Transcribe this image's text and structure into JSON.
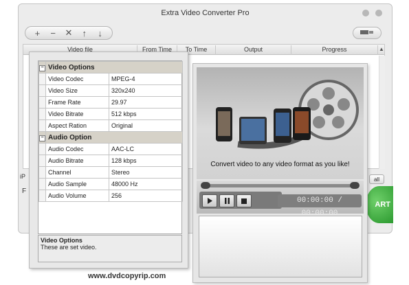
{
  "window": {
    "title": "Extra Video Converter Pro",
    "columns": [
      "Video file",
      "From Time",
      "To Time",
      "Output",
      "Progress"
    ]
  },
  "toolbar": {
    "add": "+",
    "remove": "−",
    "clear": "✕",
    "up": "↑",
    "down": "↓"
  },
  "bottom": {
    "partial_label_left": "iP",
    "partial_label_f": "F",
    "all_label": "all",
    "start_label": "ART"
  },
  "options": {
    "video_section": "Video Options",
    "video_rows": [
      {
        "name": "Video Codec",
        "value": "MPEG-4"
      },
      {
        "name": "Video Size",
        "value": "320x240"
      },
      {
        "name": "Frame Rate",
        "value": "29.97"
      },
      {
        "name": "Video Bitrate",
        "value": "512 kbps"
      },
      {
        "name": "Aspect Ration",
        "value": "Original"
      }
    ],
    "audio_section": "Audio Option",
    "audio_rows": [
      {
        "name": "Audio Codec",
        "value": "AAC-LC"
      },
      {
        "name": "Audio Bitrate",
        "value": "128 kbps"
      },
      {
        "name": "Channel",
        "value": "Stereo"
      },
      {
        "name": "Audio Sample",
        "value": "48000 Hz"
      },
      {
        "name": "Audio Volume",
        "value": "256"
      }
    ],
    "description_title": "Video Options",
    "description_text": "These are set video."
  },
  "player": {
    "promo_text": "Convert video to any video format as you like!",
    "time": "00:00:00 / 00:00:00",
    "controls": [
      "play-icon",
      "pause-icon",
      "stop-icon"
    ]
  },
  "footer": {
    "website": "www.dvdcopyrip.com"
  },
  "colors": {
    "section_bg": "#d6d2c8",
    "start_green": "#2c9a30"
  }
}
